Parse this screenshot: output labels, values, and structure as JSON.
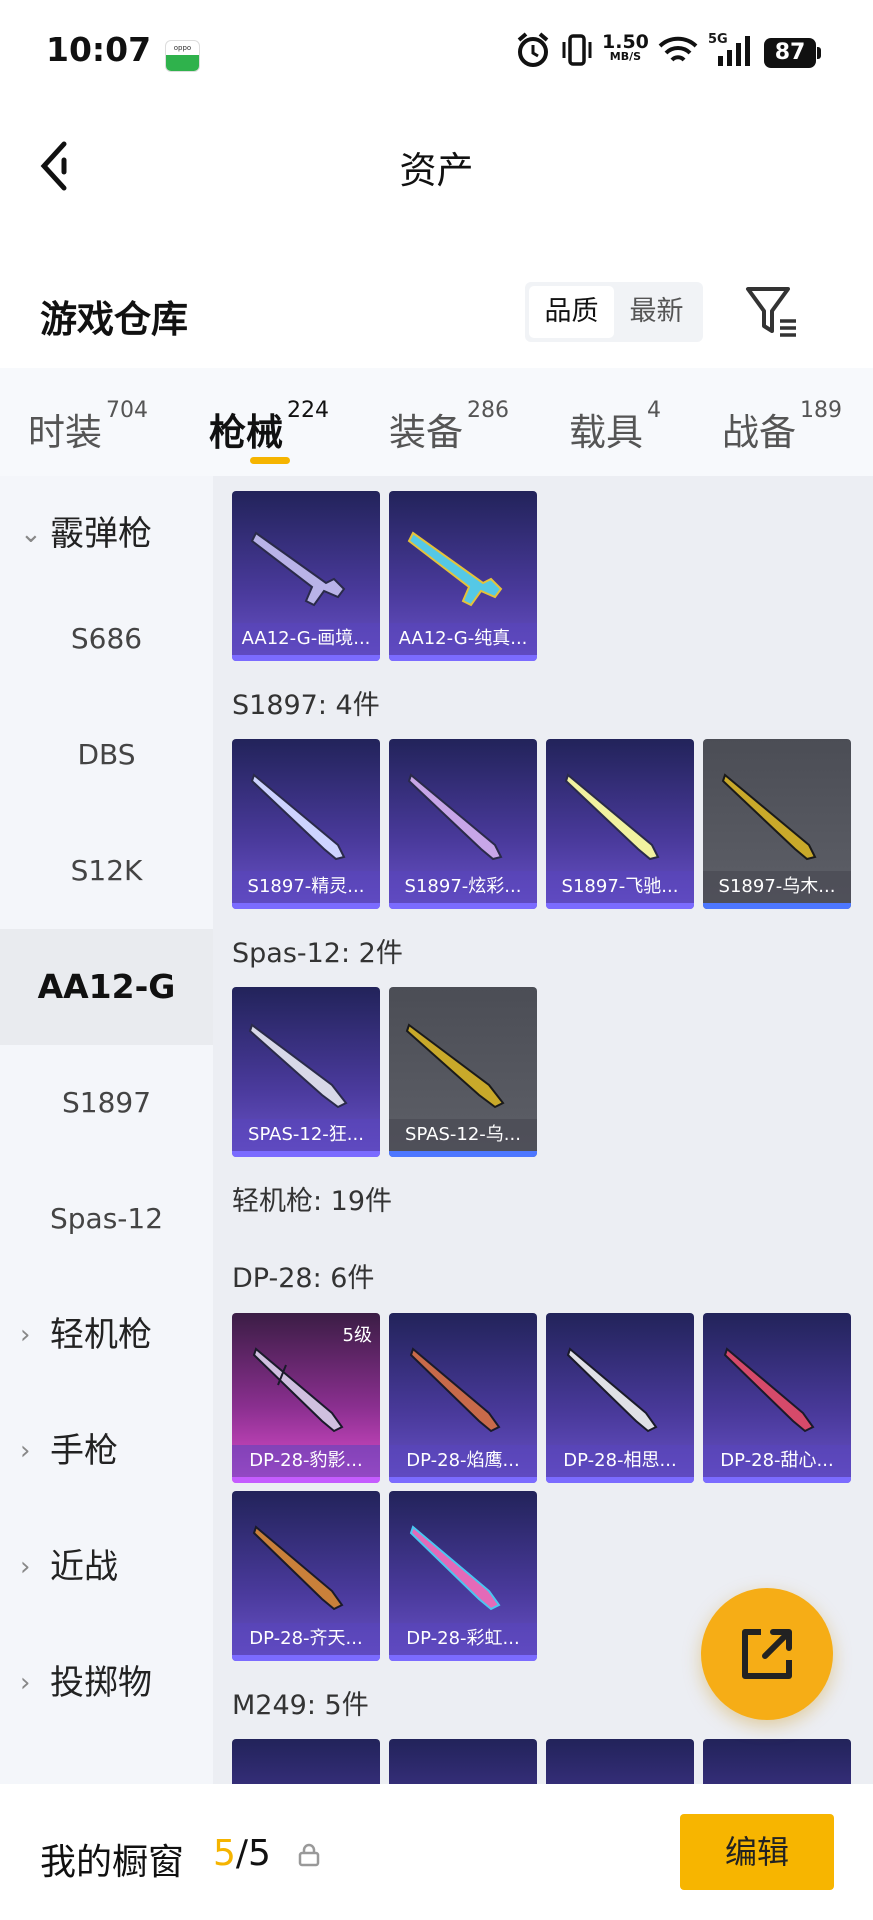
{
  "status_bar": {
    "time": "10:07",
    "net_speed_value": "1.50",
    "net_speed_unit": "MB/S",
    "network": "5G",
    "battery": "87",
    "app_icon": "oppo-app-icon"
  },
  "nav": {
    "title": "资产",
    "back_icon": "chevron-left-icon"
  },
  "header": {
    "title": "游戏仓库",
    "sort_options": [
      "品质",
      "最新"
    ],
    "selected_sort": "品质",
    "filter_icon": "filter-list-icon"
  },
  "tabs": [
    {
      "label": "时装",
      "count": "704"
    },
    {
      "label": "枪械",
      "count": "224",
      "active": true
    },
    {
      "label": "装备",
      "count": "286"
    },
    {
      "label": "载具",
      "count": "4"
    },
    {
      "label": "战备",
      "count": "189"
    }
  ],
  "sidebar": {
    "items": [
      {
        "label": "霰弹枪",
        "type": "group",
        "expanded": true
      },
      {
        "label": "S686",
        "type": "sub"
      },
      {
        "label": "DBS",
        "type": "sub"
      },
      {
        "label": "S12K",
        "type": "sub"
      },
      {
        "label": "AA12-G",
        "type": "sub",
        "active": true
      },
      {
        "label": "S1897",
        "type": "sub"
      },
      {
        "label": "Spas-12",
        "type": "sub"
      },
      {
        "label": "轻机枪",
        "type": "group"
      },
      {
        "label": "手枪",
        "type": "group"
      },
      {
        "label": "近战",
        "type": "group"
      },
      {
        "label": "投掷物",
        "type": "group"
      }
    ]
  },
  "content": {
    "groups": [
      {
        "label": "",
        "items": [
          {
            "name": "AA12-G-画境...",
            "style": "purple"
          },
          {
            "name": "AA12-G-纯真...",
            "style": "purple"
          }
        ]
      },
      {
        "label": "S1897: 4件",
        "items": [
          {
            "name": "S1897-精灵...",
            "style": "purple"
          },
          {
            "name": "S1897-炫彩...",
            "style": "purple"
          },
          {
            "name": "S1897-飞驰...",
            "style": "purple"
          },
          {
            "name": "S1897-乌木...",
            "style": "gray"
          }
        ]
      },
      {
        "label": "Spas-12: 2件",
        "items": [
          {
            "name": "SPAS-12-狂...",
            "style": "purple"
          },
          {
            "name": "SPAS-12-乌...",
            "style": "gray"
          }
        ]
      },
      {
        "label": "轻机枪: 19件",
        "items": []
      },
      {
        "label": "DP-28: 6件",
        "items": [
          {
            "name": "DP-28-豹影...",
            "style": "pink",
            "level": "5级"
          },
          {
            "name": "DP-28-焰鹰...",
            "style": "purple"
          },
          {
            "name": "DP-28-相思...",
            "style": "purple"
          },
          {
            "name": "DP-28-甜心...",
            "style": "purple"
          },
          {
            "name": "DP-28-齐天...",
            "style": "purple"
          },
          {
            "name": "DP-28-彩虹...",
            "style": "purple"
          }
        ]
      },
      {
        "label": "M249: 5件",
        "items": []
      }
    ]
  },
  "fab": {
    "icon": "share-external-icon"
  },
  "bottom_bar": {
    "label": "我的橱窗",
    "count_current": "5",
    "count_total": "/5",
    "lock_icon": "lock-icon",
    "edit_label": "编辑"
  },
  "colors": {
    "accent": "#f5b400",
    "card_purple": "#4a3a9c",
    "card_gray": "#5e6068",
    "card_pink": "#e04fd0"
  }
}
